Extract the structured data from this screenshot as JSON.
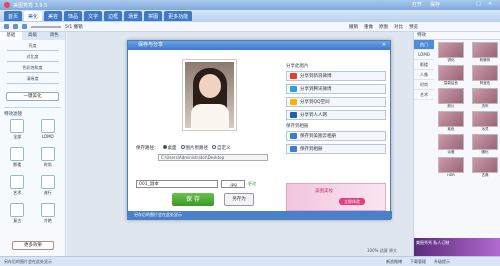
{
  "app": {
    "title": "美图秀秀 3.9.5",
    "window_buttons": [
      "打开",
      "保存",
      "□",
      "✕"
    ]
  },
  "menu": {
    "tabs": [
      "首页",
      "美化",
      "美容",
      "饰品",
      "文字",
      "边框",
      "场景",
      "拼图",
      "更多功能"
    ],
    "active": "美化",
    "right": [
      "打开",
      "保存与分享"
    ]
  },
  "toolbar": {
    "zoom_label": "5/1 撤销",
    "right_tools": [
      "撤销",
      "重做",
      "原图",
      "对比",
      "预览"
    ]
  },
  "left_panel": {
    "tabs": [
      "基础",
      "高级",
      "调色"
    ],
    "sliders": [
      "亮度",
      "对比度",
      "色彩饱和度",
      "清晰度"
    ],
    "onekey": "一键美化",
    "effects_title": "特效滤镜",
    "effects": [
      "全部",
      "LOMO",
      "影楼",
      "时尚",
      "艺术",
      "流行",
      "复古",
      "冷艳"
    ],
    "more": "更多效果"
  },
  "right_panel": {
    "header": "特效",
    "categories": [
      "热门",
      "LOMO",
      "影楼",
      "人像",
      "时尚",
      "艺术"
    ],
    "thumbs": [
      "锐化",
      "粉嫩系",
      "智能绘色",
      "阿宝色",
      "胶片",
      "流年",
      "紫色",
      "冰灵",
      "淡雅",
      "暖化",
      "HDR",
      "古典"
    ],
    "ad": "美图秀秀 私人订制"
  },
  "dialog": {
    "title": "保存与分享",
    "close": "✕",
    "save_path_label": "保存路径：",
    "path_options": [
      "桌面",
      "图片原路径",
      "自定义"
    ],
    "path_value": "C:\\Users\\Administrator\\Desktop",
    "filename": "001_副本",
    "format": ".jpg",
    "change_label": "更改",
    "save_button": "保 存",
    "saveas_button": "另存为",
    "share_title": "分享此图片",
    "share_buttons": [
      "分享到新浪微博",
      "分享到腾讯微博",
      "分享到QQ空间",
      "分享到人人网"
    ],
    "other_title": "保存到相册",
    "other_buttons": [
      "保存到美图云相册",
      "保存到相册"
    ],
    "promo_text": "美图美妆",
    "promo_button": "立即体验",
    "footer": "另存后的图片会在此处显示"
  },
  "canvas": {
    "zoom": "100%  适屏  原大"
  },
  "status": {
    "left": "另存后的图片会在此处显示",
    "right": [
      "新浪微博",
      "下载管理",
      "升级提示"
    ]
  }
}
